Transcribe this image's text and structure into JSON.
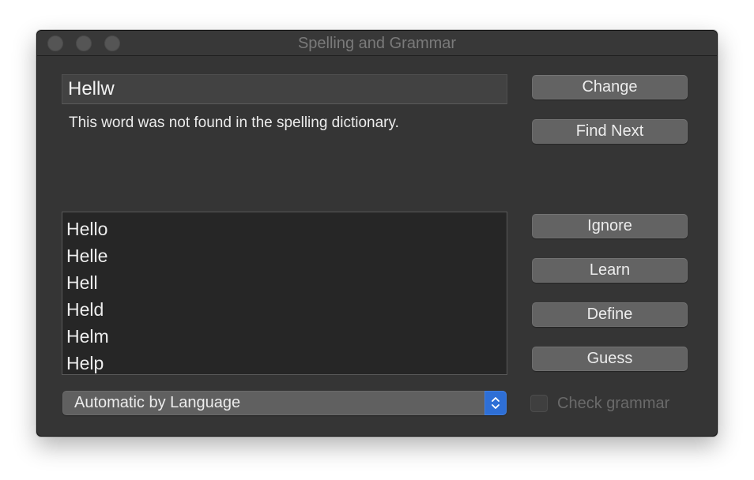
{
  "window": {
    "title": "Spelling and Grammar"
  },
  "word_field": {
    "value": "Hellw"
  },
  "message": "This word was not found in the spelling dictionary.",
  "guesses": [
    "Hello",
    "Helle",
    "Hell",
    "Held",
    "Helm",
    "Help"
  ],
  "buttons": {
    "change": "Change",
    "find_next": "Find Next",
    "ignore": "Ignore",
    "learn": "Learn",
    "define": "Define",
    "guess": "Guess"
  },
  "language_popup": {
    "selected": "Automatic by Language"
  },
  "check_grammar": {
    "label": "Check grammar",
    "checked": false
  },
  "icons": {
    "traffic_lights": [
      "close-icon",
      "minimize-icon",
      "zoom-icon"
    ],
    "popup_arrows": "chevron-up-down-icon"
  },
  "colors": {
    "window_bg": "#353535",
    "list_bg": "#262626",
    "button_bg": "#636363",
    "accent": "#2e6fd6"
  }
}
